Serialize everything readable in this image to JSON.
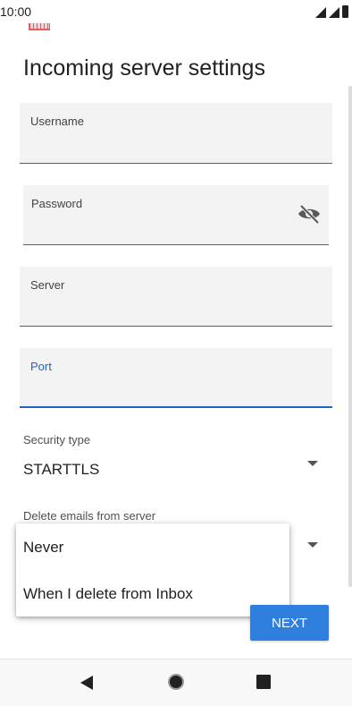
{
  "status_bar": {
    "time": "10:00"
  },
  "title": "Incoming server settings",
  "fields": {
    "username": {
      "label": "Username",
      "value": ""
    },
    "password": {
      "label": "Password",
      "value": ""
    },
    "server": {
      "label": "Server",
      "value": ""
    },
    "port": {
      "label": "Port",
      "value": ""
    }
  },
  "security": {
    "label": "Security type",
    "value": "STARTTLS"
  },
  "delete_emails": {
    "label": "Delete emails from server",
    "options": [
      "Never",
      "When I delete from Inbox"
    ]
  },
  "buttons": {
    "next": "NEXT"
  },
  "icons": {
    "password_toggle": "eye-off-icon",
    "nav_back": "back-triangle-icon",
    "nav_home": "home-circle-icon",
    "nav_recents": "recents-square-icon"
  },
  "colors": {
    "accent": "#1e63c8",
    "button": "#2f7fdf",
    "field_bg": "#f3f3f3"
  }
}
